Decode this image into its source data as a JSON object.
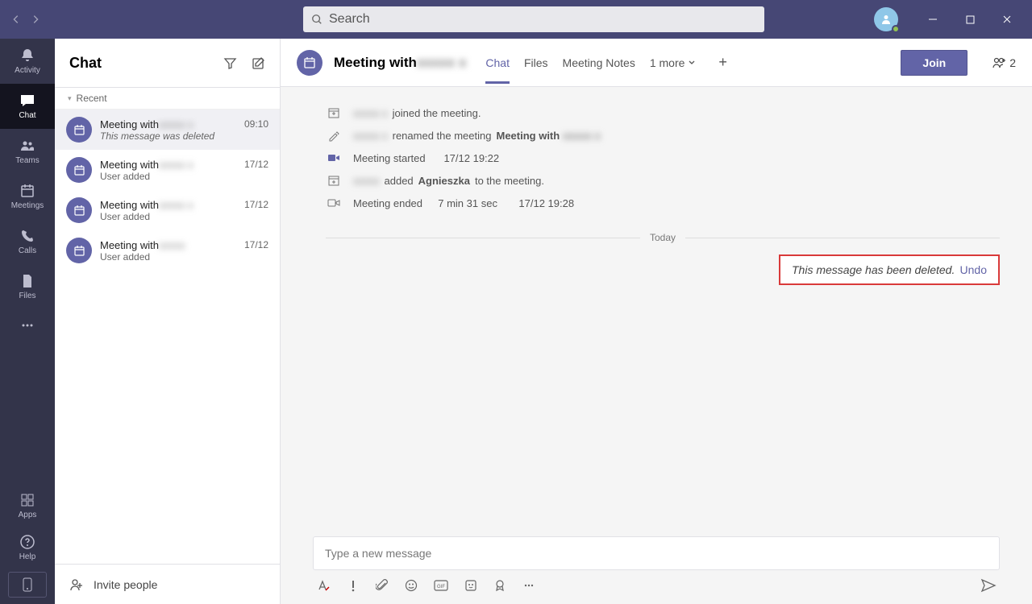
{
  "titlebar": {
    "search_placeholder": "Search"
  },
  "rail": {
    "activity": "Activity",
    "chat": "Chat",
    "teams": "Teams",
    "meetings": "Meetings",
    "calls": "Calls",
    "files": "Files",
    "apps": "Apps",
    "help": "Help"
  },
  "leftpane": {
    "title": "Chat",
    "section": "Recent",
    "invite": "Invite people",
    "items": [
      {
        "title_prefix": "Meeting with ",
        "title_blur": "xxxxx x",
        "time": "09:10",
        "sub": "This message was deleted",
        "italic": true,
        "selected": true
      },
      {
        "title_prefix": "Meeting with ",
        "title_blur": "xxxxx x",
        "time": "17/12",
        "sub": "User added",
        "italic": false
      },
      {
        "title_prefix": "Meeting with ",
        "title_blur": "xxxxx x",
        "time": "17/12",
        "sub": "User added",
        "italic": false
      },
      {
        "title_prefix": "Meeting with ",
        "title_blur": "xxxxx",
        "time": "17/12",
        "sub": "User added",
        "italic": false
      }
    ]
  },
  "main": {
    "title_prefix": "Meeting with ",
    "title_blur": "xxxxx x",
    "tabs": {
      "chat": "Chat",
      "files": "Files",
      "notes": "Meeting Notes",
      "more": "1 more"
    },
    "join": "Join",
    "participants": "2"
  },
  "convo": {
    "joined_suffix": " joined the meeting.",
    "renamed_mid": " renamed the meeting ",
    "renamed_bold": "Meeting with ",
    "started": "Meeting started",
    "started_time": "17/12 19:22",
    "added_mid": " added ",
    "added_bold": "Agnieszka",
    "added_suffix": " to the meeting.",
    "ended": "Meeting ended",
    "ended_dur": "7 min 31 sec",
    "ended_time": "17/12 19:28",
    "divider": "Today",
    "deleted_text": "This message has been deleted.",
    "undo": "Undo"
  },
  "composer": {
    "placeholder": "Type a new message"
  }
}
